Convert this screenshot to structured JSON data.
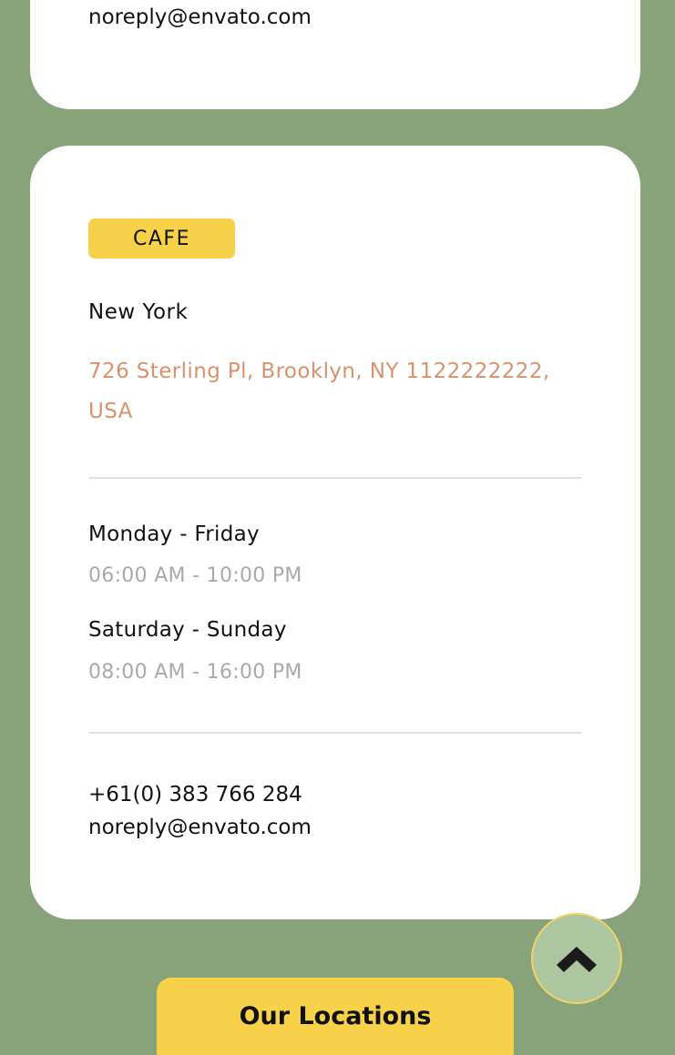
{
  "top_card": {
    "email": "noreply@envato.com"
  },
  "location_card": {
    "category_badge": "CAFE",
    "city": "New York",
    "address": "726 Sterling Pl, Brooklyn, NY 1122222222, USA",
    "hours": [
      {
        "days": "Monday - Friday",
        "time": "06:00 AM - 10:00 PM"
      },
      {
        "days": "Saturday - Sunday",
        "time": "08:00 AM - 16:00 PM"
      }
    ],
    "phone": "+61(0) 383 766 284",
    "email": "noreply@envato.com"
  },
  "scroll_top_icon": "chevron-up-icon",
  "locations_button": {
    "label": "Our Locations"
  },
  "colors": {
    "page_background": "#88a27a",
    "card_background": "#ffffff",
    "badge_background": "#f7d14a",
    "address_color": "#d8926b",
    "muted_text": "#a9a9a9",
    "scroll_button_background": "#adc6a0"
  }
}
